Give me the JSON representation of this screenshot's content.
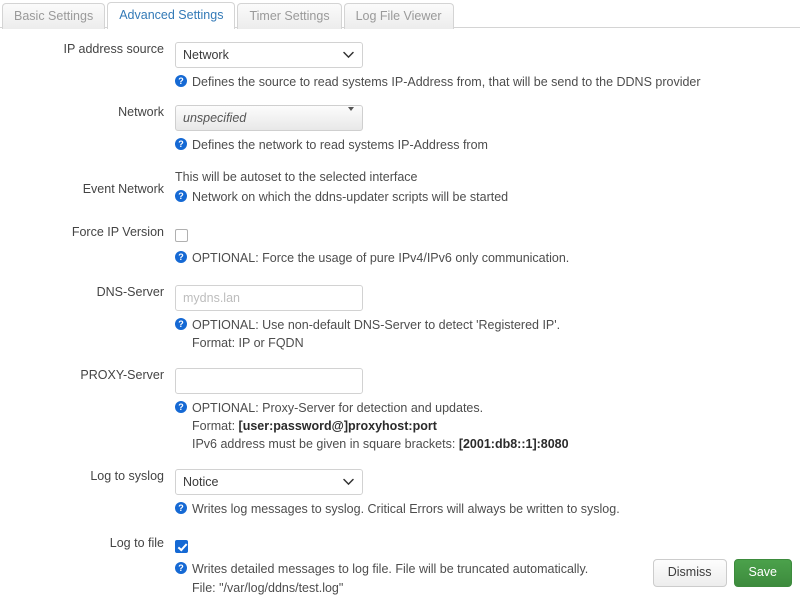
{
  "tabs": [
    {
      "label": "Basic Settings",
      "active": false
    },
    {
      "label": "Advanced Settings",
      "active": true
    },
    {
      "label": "Timer Settings",
      "active": false
    },
    {
      "label": "Log File Viewer",
      "active": false
    }
  ],
  "colors": {
    "accent": "#337ab7",
    "help_icon": "#1569d4",
    "save_button": "#3d8b3d",
    "checkbox_checked": "#1569d4"
  },
  "rows": {
    "ip_address_source": {
      "label": "IP address source",
      "value": "Network",
      "help": "Defines the source to read systems IP-Address from, that will be send to the DDNS provider"
    },
    "network": {
      "label": "Network",
      "value": "unspecified",
      "help": "Defines the network to read systems IP-Address from"
    },
    "event_network": {
      "label": "Event Network",
      "value": "This will be autoset to the selected interface",
      "help": "Network on which the ddns-updater scripts will be started"
    },
    "force_ip_version": {
      "label": "Force IP Version",
      "checked": false,
      "help": "OPTIONAL: Force the usage of pure IPv4/IPv6 only communication."
    },
    "dns_server": {
      "label": "DNS-Server",
      "value": "",
      "placeholder": "mydns.lan",
      "help": "OPTIONAL: Use non-default DNS-Server to detect 'Registered IP'.",
      "help_line2": "Format: IP or FQDN"
    },
    "proxy_server": {
      "label": "PROXY-Server",
      "value": "",
      "placeholder": "",
      "help": "OPTIONAL: Proxy-Server for detection and updates.",
      "help_line2_pre": "Format: ",
      "help_line2_bold": "[user:password@]proxyhost:port",
      "help_line3_pre": "IPv6 address must be given in square brackets: ",
      "help_line3_bold": "[2001:db8::1]:8080"
    },
    "log_to_syslog": {
      "label": "Log to syslog",
      "value": "Notice",
      "help": "Writes log messages to syslog. Critical Errors will always be written to syslog."
    },
    "log_to_file": {
      "label": "Log to file",
      "checked": true,
      "help": "Writes detailed messages to log file. File will be truncated automatically.",
      "help_line2": "File: \"/var/log/ddns/test.log\""
    }
  },
  "footer": {
    "dismiss_label": "Dismiss",
    "save_label": "Save"
  },
  "icons": {
    "help": "?",
    "chevron_down": "chevron-down-icon",
    "triangle_down": "triangle-down-icon",
    "checkmark": "check-icon"
  }
}
